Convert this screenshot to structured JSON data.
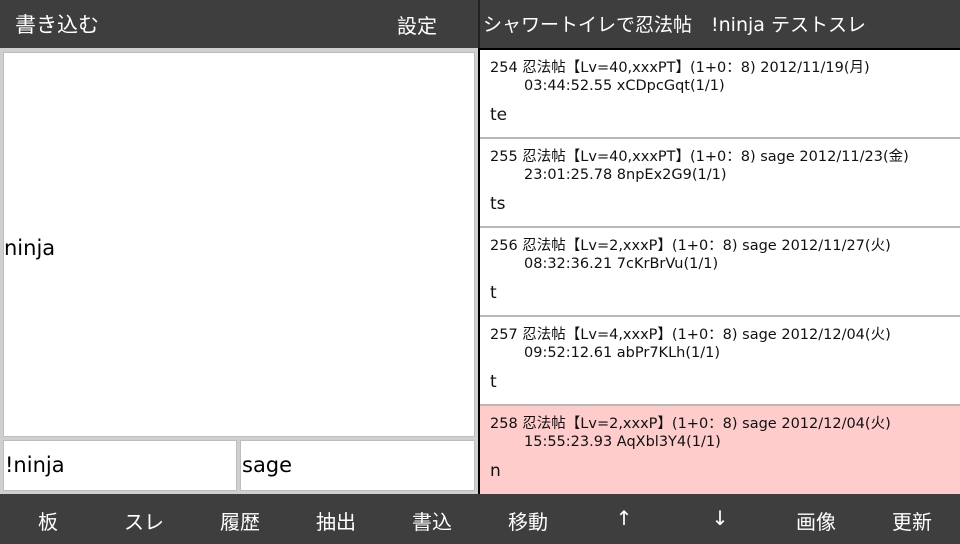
{
  "write_panel": {
    "title": "書き込む",
    "settings_label": "設定",
    "message": "ninja",
    "name_value": "!ninja",
    "mail_value": "sage"
  },
  "thread": {
    "title": "シャワートイレで忍法帖　!ninja テストスレ",
    "highlight_color": "#ffcccc",
    "posts": [
      {
        "line1": "254  忍法帖【Lv=40,xxxPT】(1+0：8)   2012/11/19(月)",
        "line2": "03:44:52.55 xCDpcGqt(1/1)",
        "body": "te"
      },
      {
        "line1": "255  忍法帖【Lv=40,xxxPT】(1+0：8)  sage 2012/11/23(金)",
        "line2": "23:01:25.78 8npEx2G9(1/1)",
        "body": "ts"
      },
      {
        "line1": "256  忍法帖【Lv=2,xxxP】(1+0：8)  sage 2012/11/27(火)",
        "line2": "08:32:36.21 7cKrBrVu(1/1)",
        "body": "t"
      },
      {
        "line1": "257  忍法帖【Lv=4,xxxP】(1+0：8)  sage 2012/12/04(火)",
        "line2": "09:52:12.61 abPr7KLh(1/1)",
        "body": "t"
      },
      {
        "line1": "258  忍法帖【Lv=2,xxxP】(1+0：8)  sage 2012/12/04(火)",
        "line2": "15:55:23.93 AqXbl3Y4(1/1)",
        "body": "n"
      }
    ]
  },
  "bottom_nav": [
    "板",
    "スレ",
    "履歴",
    "抽出",
    "書込",
    "移動",
    "↑",
    "↓",
    "画像",
    "更新"
  ]
}
